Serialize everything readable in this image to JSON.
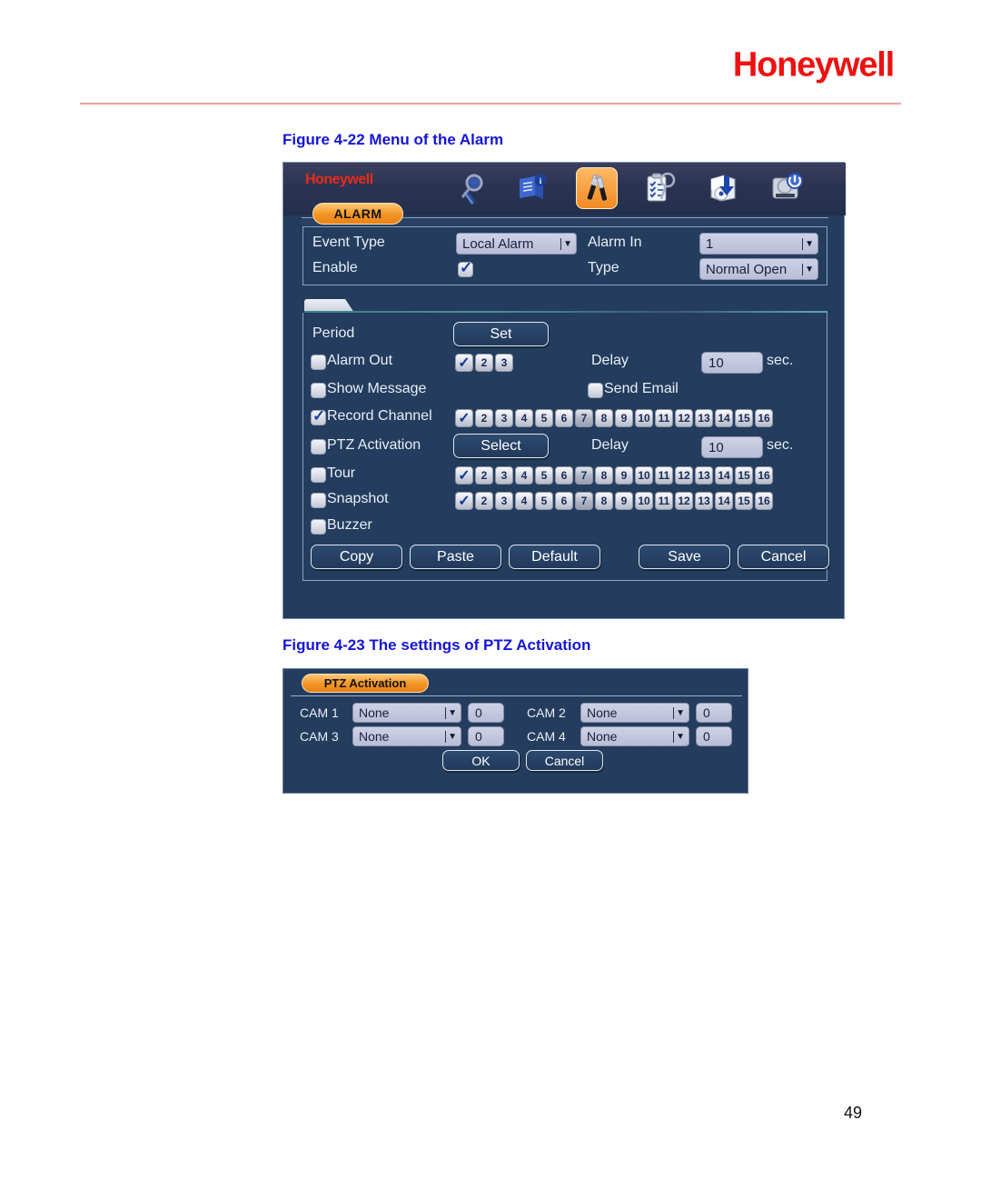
{
  "document": {
    "brand": "Honeywell",
    "page_number": "49",
    "figure_22_caption": "Figure 4-22 Menu of the Alarm",
    "figure_23_caption": "Figure 4-23 The settings of PTZ Activation"
  },
  "colors": {
    "panel_bg": "#243d5e",
    "accent_orange": "#f39423",
    "brand_red": "#ee1111",
    "caption_blue": "#1414d6",
    "field_bg": "#c6cade"
  },
  "alarm_window": {
    "brand_mini": "Honeywell",
    "tab_label": "ALARM",
    "toolbar_icons": [
      "search-icon",
      "info-log-icon",
      "tools-settings-icon",
      "event-list-icon",
      "backup-icon",
      "shutdown-icon"
    ],
    "active_toolbar_icon": "tools-settings-icon",
    "fields": {
      "event_type_label": "Event Type",
      "event_type_value": "Local Alarm",
      "alarm_in_label": "Alarm In",
      "alarm_in_value": "1",
      "enable_label": "Enable",
      "enable_checked": true,
      "type_label": "Type",
      "type_value": "Normal Open"
    },
    "rows": {
      "period_label": "Period",
      "period_button": "Set",
      "alarm_out_label": "Alarm Out",
      "alarm_out_checked": false,
      "alarm_out_channels": [
        "1",
        "2",
        "3"
      ],
      "alarm_out_delay_label": "Delay",
      "alarm_out_delay_value": "10",
      "alarm_out_delay_unit": "sec.",
      "show_message_label": "Show Message",
      "show_message_checked": false,
      "send_email_label": "Send Email",
      "send_email_checked": false,
      "record_channel_label": "Record Channel",
      "record_channel_checked": true,
      "ptz_activation_label": "PTZ Activation",
      "ptz_activation_checked": false,
      "ptz_button": "Select",
      "ptz_delay_label": "Delay",
      "ptz_delay_value": "10",
      "ptz_delay_unit": "sec.",
      "tour_label": "Tour",
      "tour_checked": false,
      "snapshot_label": "Snapshot",
      "snapshot_checked": false,
      "buzzer_label": "Buzzer",
      "buzzer_checked": false,
      "channels_16": [
        "1",
        "2",
        "3",
        "4",
        "5",
        "6",
        "7",
        "8",
        "9",
        "10",
        "11",
        "12",
        "13",
        "14",
        "15",
        "16"
      ],
      "channel_checked_index": 0,
      "channel_highlight_index": 6
    },
    "buttons": {
      "copy": "Copy",
      "paste": "Paste",
      "default": "Default",
      "save": "Save",
      "cancel": "Cancel"
    }
  },
  "ptz_dialog": {
    "title": "PTZ Activation",
    "cams": [
      {
        "label": "CAM 1",
        "mode": "None",
        "value": "0"
      },
      {
        "label": "CAM 2",
        "mode": "None",
        "value": "0"
      },
      {
        "label": "CAM 3",
        "mode": "None",
        "value": "0"
      },
      {
        "label": "CAM 4",
        "mode": "None",
        "value": "0"
      }
    ],
    "ok_button": "OK",
    "cancel_button": "Cancel"
  }
}
